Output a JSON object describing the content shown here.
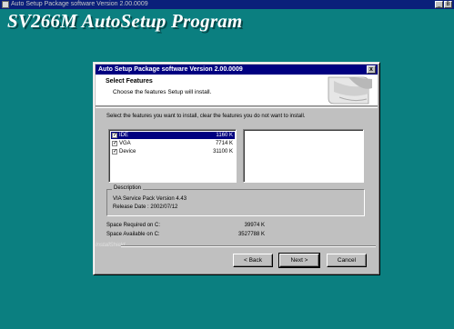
{
  "window": {
    "caption": "Auto Setup Package software Version 2.00.0009",
    "controls": [
      "_",
      "B"
    ]
  },
  "banner": "SV266M AutoSetup Program",
  "dialog": {
    "title": "Auto Setup Package software Version 2.00.0009",
    "close_label": "x",
    "header_title": "Select Features",
    "header_subtitle": "Choose the features Setup will install.",
    "instruction": "Select the features you want to install, clear the features you do not want to install.",
    "features": [
      {
        "name": "IDE",
        "size": "1160 K",
        "checked": true,
        "selected": true
      },
      {
        "name": "VGA",
        "size": "7714 K",
        "checked": true,
        "selected": false
      },
      {
        "name": "Device",
        "size": "31100 K",
        "checked": true,
        "selected": false
      }
    ],
    "description": {
      "legend": "Description",
      "line1": "VIA Service Pack Version 4.43",
      "line2": "Release Date : 2002/07/12"
    },
    "space_required_label": "Space Required on  C:",
    "space_required_value": "39974 K",
    "space_available_label": "Space Available on  C:",
    "space_available_value": "3527788 K",
    "installer_brand": "InstallShield",
    "buttons": {
      "back": "< Back",
      "next": "Next >",
      "cancel": "Cancel"
    }
  }
}
